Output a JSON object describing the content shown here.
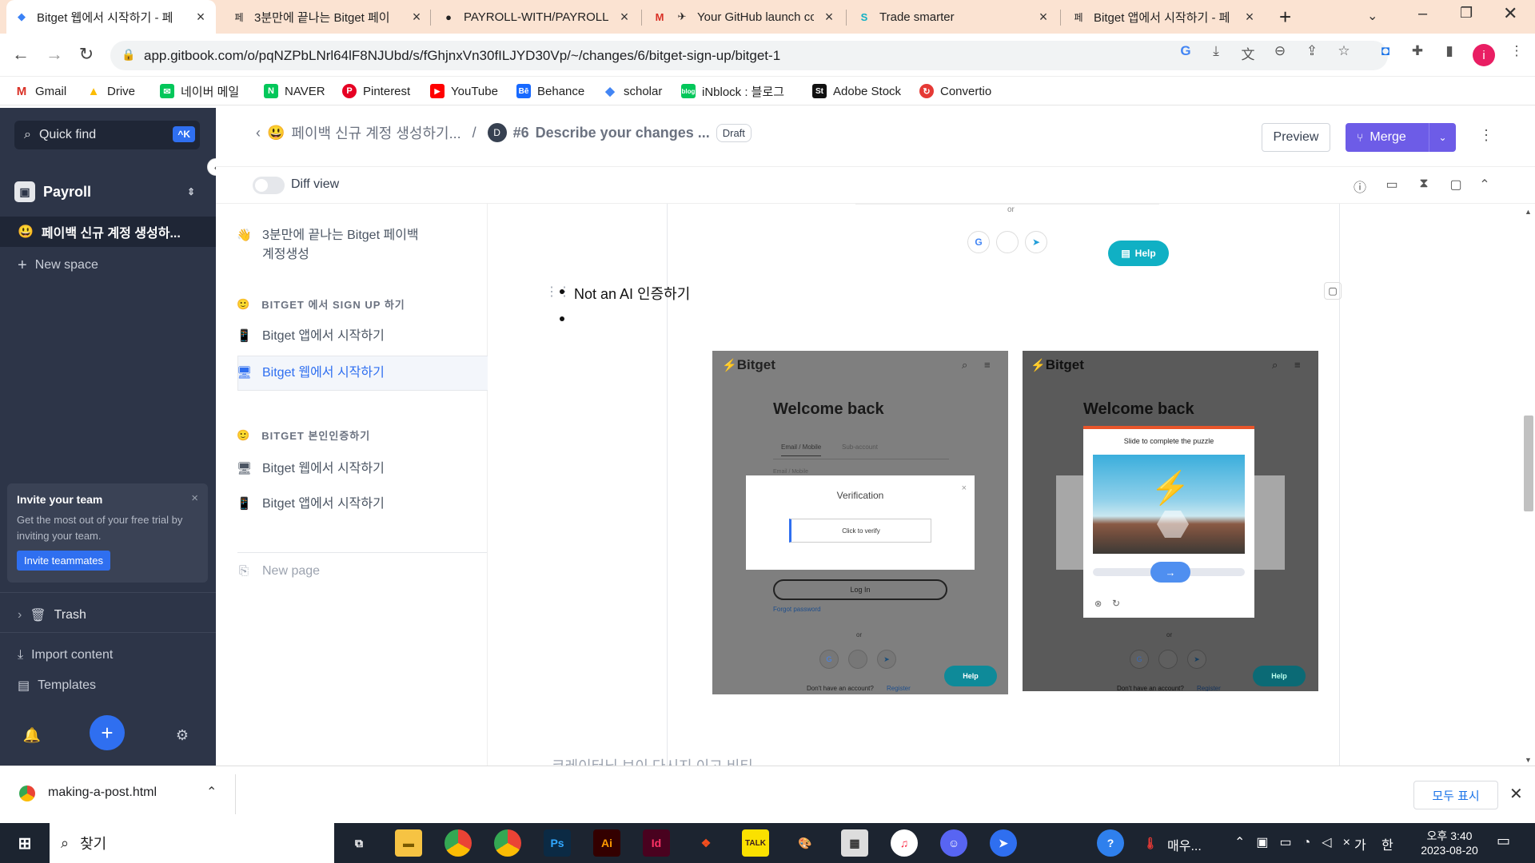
{
  "browser": {
    "tabs": [
      {
        "title": "Bitget 웹에서 시작하기 - 페",
        "active": true
      },
      {
        "title": "3분만에 끝나는 Bitget 페이"
      },
      {
        "title": "PAYROLL-WITH/PAYROLL"
      },
      {
        "title": "Your GitHub launch co"
      },
      {
        "title": "Trade smarter"
      },
      {
        "title": "Bitget 앱에서 시작하기 - 페"
      }
    ],
    "url": "app.gitbook.com/o/pqNZPbLNrl64lF8NJUbd/s/fGhjnxVn30fILJYD30Vp/~/changes/6/bitget-sign-up/bitget-1",
    "bookmarks": [
      "Gmail",
      "Drive",
      "네이버 메일",
      "NAVER",
      "Pinterest",
      "YouTube",
      "Behance",
      "scholar",
      "iNblock : 블로그",
      "Adobe Stock",
      "Convertio"
    ]
  },
  "sidebar": {
    "quick_find": "Quick find",
    "shortcut": "^K",
    "space": "Payroll",
    "active_page": "페이백 신규 계정 생성하...",
    "new_space": "New space",
    "invite": {
      "title": "Invite your team",
      "text": "Get the most out of your free trial by inviting your team.",
      "button": "Invite teammates"
    },
    "trash": "Trash",
    "import": "Import content",
    "templates": "Templates"
  },
  "header": {
    "breadcrumb_space": "페이백 신규 계정 생성하기...",
    "change_number": "#6",
    "change_title": "Describe your changes ...",
    "status": "Draft",
    "avatar": "D",
    "preview": "Preview",
    "merge": "Merge",
    "diff_view": "Diff view"
  },
  "pagenav": {
    "intro": "3분만에 끝나는 Bitget 페이백 계정생성",
    "group1": "BITGET 에서 SIGN UP 하기",
    "group1_items": [
      "Bitget 앱에서 시작하기",
      "Bitget 웹에서 시작하기"
    ],
    "group2": "BITGET 본인인증하기",
    "group2_items": [
      "Bitget 웹에서 시작하기",
      "Bitget 앱에서 시작하기"
    ],
    "new_page": "New page"
  },
  "content": {
    "or_text": "or",
    "help": "Help",
    "bullet": "Not an AI 인증하기",
    "shot1": {
      "logo": "Bitget",
      "heading": "Welcome back",
      "tab_email": "Email / Mobile",
      "tab_sub": "Sub-account",
      "field_label": "Email / Mobile",
      "modal_title": "Verification",
      "verify_button": "Click to verify",
      "login": "Log In",
      "forgot": "Forgot password",
      "or": "or",
      "account": "Don't have an account?",
      "register": "Register",
      "help": "Help"
    },
    "shot2": {
      "logo": "Bitget",
      "heading": "Welcome back",
      "puzzle_title": "Slide to complete the puzzle",
      "or": "or",
      "account": "Don't have an account?",
      "register": "Register",
      "help": "Help"
    },
    "next_heading": "코레이터님 보이 다시지 이고 비티"
  },
  "download": {
    "file": "making-a-post.html",
    "show_all": "모두 표시"
  },
  "taskbar": {
    "search": "찾기",
    "weather": "매우...",
    "ime": "가",
    "lang": "한",
    "time": "오후 3:40",
    "date": "2023-08-20"
  }
}
